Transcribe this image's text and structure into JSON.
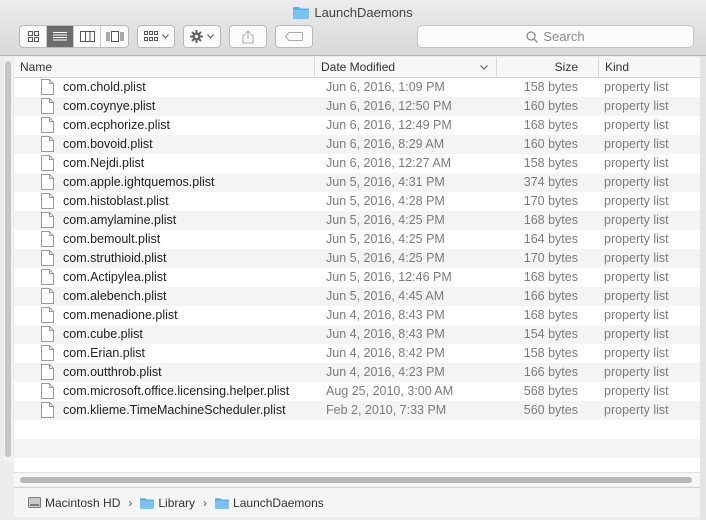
{
  "window": {
    "title": "LaunchDaemons"
  },
  "toolbar": {
    "search_placeholder": "Search",
    "view_modes": [
      "icon-view",
      "list-view",
      "column-view",
      "cover-flow-view"
    ]
  },
  "columns": {
    "name": "Name",
    "date": "Date Modified",
    "size": "Size",
    "kind": "Kind"
  },
  "files": [
    {
      "name": "com.chold.plist",
      "date": "Jun 6, 2016, 1:09 PM",
      "size": "158 bytes",
      "kind": "property list"
    },
    {
      "name": "com.coynye.plist",
      "date": "Jun 6, 2016, 12:50 PM",
      "size": "160 bytes",
      "kind": "property list"
    },
    {
      "name": "com.ecphorize.plist",
      "date": "Jun 6, 2016, 12:49 PM",
      "size": "168 bytes",
      "kind": "property list"
    },
    {
      "name": "com.bovoid.plist",
      "date": "Jun 6, 2016, 8:29 AM",
      "size": "160 bytes",
      "kind": "property list"
    },
    {
      "name": "com.Nejdi.plist",
      "date": "Jun 6, 2016, 12:27 AM",
      "size": "158 bytes",
      "kind": "property list"
    },
    {
      "name": "com.apple.ightquemos.plist",
      "date": "Jun 5, 2016, 4:31 PM",
      "size": "374 bytes",
      "kind": "property list"
    },
    {
      "name": "com.histoblast.plist",
      "date": "Jun 5, 2016, 4:28 PM",
      "size": "170 bytes",
      "kind": "property list"
    },
    {
      "name": "com.amylamine.plist",
      "date": "Jun 5, 2016, 4:25 PM",
      "size": "168 bytes",
      "kind": "property list"
    },
    {
      "name": "com.bemoult.plist",
      "date": "Jun 5, 2016, 4:25 PM",
      "size": "164 bytes",
      "kind": "property list"
    },
    {
      "name": "com.struthioid.plist",
      "date": "Jun 5, 2016, 4:25 PM",
      "size": "170 bytes",
      "kind": "property list"
    },
    {
      "name": "com.Actipylea.plist",
      "date": "Jun 5, 2016, 12:46 PM",
      "size": "168 bytes",
      "kind": "property list"
    },
    {
      "name": "com.alebench.plist",
      "date": "Jun 5, 2016, 4:45 AM",
      "size": "166 bytes",
      "kind": "property list"
    },
    {
      "name": "com.menadione.plist",
      "date": "Jun 4, 2016, 8:43 PM",
      "size": "168 bytes",
      "kind": "property list"
    },
    {
      "name": "com.cube.plist",
      "date": "Jun 4, 2016, 8:43 PM",
      "size": "154 bytes",
      "kind": "property list"
    },
    {
      "name": "com.Erian.plist",
      "date": "Jun 4, 2016, 8:42 PM",
      "size": "158 bytes",
      "kind": "property list"
    },
    {
      "name": "com.outthrob.plist",
      "date": "Jun 4, 2016, 4:23 PM",
      "size": "166 bytes",
      "kind": "property list"
    },
    {
      "name": "com.microsoft.office.licensing.helper.plist",
      "date": "Aug 25, 2010, 3:00 AM",
      "size": "568 bytes",
      "kind": "property list"
    },
    {
      "name": "com.klieme.TimeMachineScheduler.plist",
      "date": "Feb 2, 2010, 7:33 PM",
      "size": "560 bytes",
      "kind": "property list"
    }
  ],
  "pathbar": [
    {
      "label": "Macintosh HD",
      "icon": "hard-drive-icon"
    },
    {
      "label": "Library",
      "icon": "folder-icon"
    },
    {
      "label": "LaunchDaemons",
      "icon": "folder-icon"
    }
  ],
  "colors": {
    "folder": "#5aaee8",
    "selected_view": "#6c6c6c"
  }
}
